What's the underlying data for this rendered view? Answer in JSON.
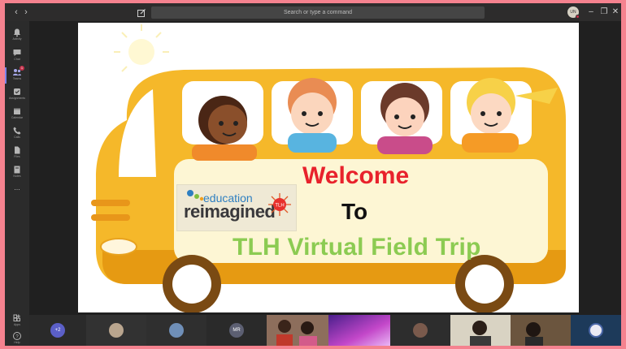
{
  "titlebar": {
    "back_icon": "‹",
    "forward_icon": "›",
    "search_placeholder": "Search or type a command",
    "user_initials": "UN",
    "minimize": "–",
    "restore": "❐",
    "close": "✕"
  },
  "rail": {
    "items": [
      {
        "label": "Activity"
      },
      {
        "label": "Chat"
      },
      {
        "label": "Teams",
        "badge": "1"
      },
      {
        "label": "Assignments"
      },
      {
        "label": "Calendar"
      },
      {
        "label": "Calls"
      },
      {
        "label": "Files"
      },
      {
        "label": "Notes"
      },
      {
        "label": "..."
      }
    ],
    "bottom": [
      {
        "label": "Apps"
      },
      {
        "label": "Help"
      }
    ]
  },
  "slide": {
    "welcome": "Welcome",
    "to": "To",
    "trip": "TLH Virtual Field Trip",
    "logo_top": "education",
    "logo_bottom": "reimagined",
    "logo_badge": "TLH"
  },
  "participants": [
    {
      "initials": "+2"
    },
    {
      "initials": ""
    },
    {
      "initials": ""
    },
    {
      "initials": "MR"
    },
    {
      "initials": ""
    },
    {
      "initials": ""
    },
    {
      "initials": ""
    },
    {
      "initials": ""
    },
    {
      "initials": ""
    },
    {
      "initials": ""
    }
  ],
  "colors": {
    "frame": "#f5828f",
    "bus": "#f5b82a",
    "welcome": "#e8222c",
    "trip": "#8ccb52",
    "teams_accent": "#7b83eb"
  }
}
